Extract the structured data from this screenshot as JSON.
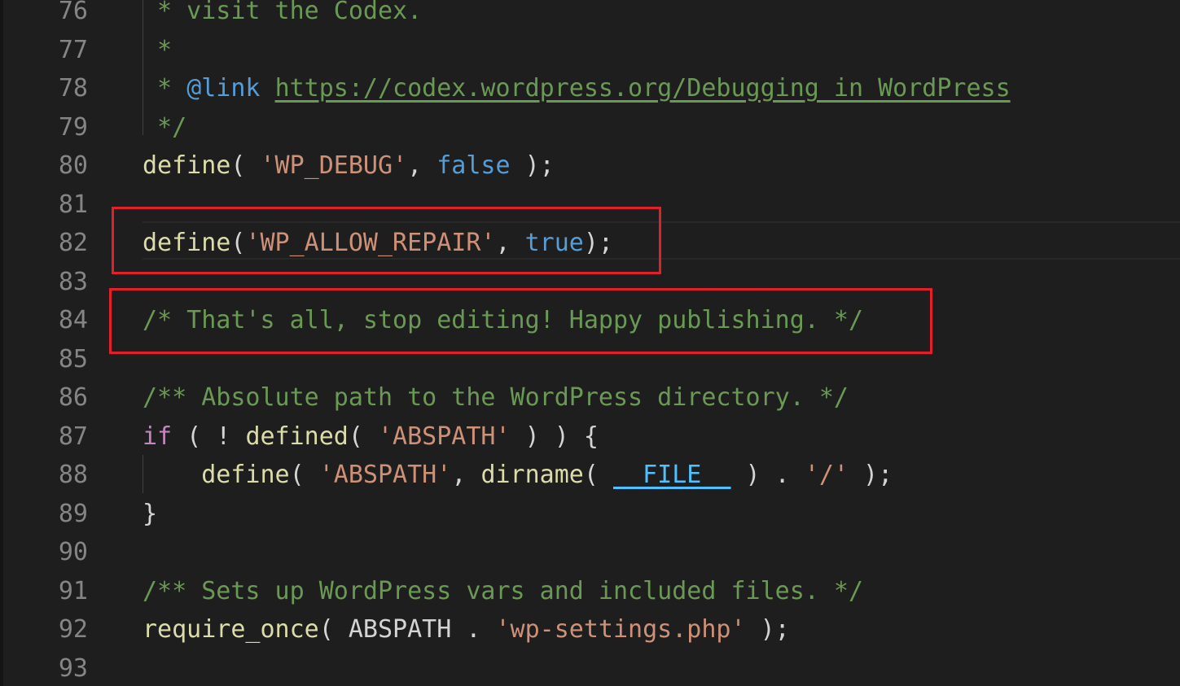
{
  "editor": {
    "lines": [
      {
        "n": "76",
        "tokens": [
          {
            "t": " * visit the Codex.",
            "c": "c-cm"
          }
        ]
      },
      {
        "n": "77",
        "tokens": [
          {
            "t": " *",
            "c": "c-cm"
          }
        ]
      },
      {
        "n": "78",
        "tokens": [
          {
            "t": " * ",
            "c": "c-cm"
          },
          {
            "t": "@link",
            "c": "c-tag"
          },
          {
            "t": " ",
            "c": "c-cm"
          },
          {
            "t": "https://codex.wordpress.org/Debugging_in_WordPress",
            "c": "c-url"
          }
        ]
      },
      {
        "n": "79",
        "tokens": [
          {
            "t": " */",
            "c": "c-cm"
          }
        ]
      },
      {
        "n": "80",
        "tokens": [
          {
            "t": "define",
            "c": "c-fn"
          },
          {
            "t": "( ",
            "c": "c-txt"
          },
          {
            "t": "'WP_DEBUG'",
            "c": "c-str"
          },
          {
            "t": ", ",
            "c": "c-txt"
          },
          {
            "t": "false",
            "c": "c-kw"
          },
          {
            "t": " );",
            "c": "c-txt"
          }
        ]
      },
      {
        "n": "81",
        "tokens": []
      },
      {
        "n": "82",
        "tokens": [
          {
            "t": "define",
            "c": "c-fn"
          },
          {
            "t": "(",
            "c": "c-txt"
          },
          {
            "t": "'WP_ALLOW_REPAIR'",
            "c": "c-str"
          },
          {
            "t": ", ",
            "c": "c-txt"
          },
          {
            "t": "true",
            "c": "c-kw"
          },
          {
            "t": ");",
            "c": "c-txt"
          }
        ]
      },
      {
        "n": "83",
        "tokens": []
      },
      {
        "n": "84",
        "tokens": [
          {
            "t": "/* That's all, stop editing! Happy publishing. */",
            "c": "c-cm"
          }
        ]
      },
      {
        "n": "85",
        "tokens": []
      },
      {
        "n": "86",
        "tokens": [
          {
            "t": "/** Absolute path to the WordPress directory. */",
            "c": "c-cm"
          }
        ]
      },
      {
        "n": "87",
        "tokens": [
          {
            "t": "if",
            "c": "c-ctl"
          },
          {
            "t": " ( ! ",
            "c": "c-txt"
          },
          {
            "t": "defined",
            "c": "c-fn"
          },
          {
            "t": "( ",
            "c": "c-txt"
          },
          {
            "t": "'ABSPATH'",
            "c": "c-str"
          },
          {
            "t": " ) ) {",
            "c": "c-txt"
          }
        ]
      },
      {
        "n": "88",
        "tokens": [
          {
            "t": "    ",
            "c": "c-txt"
          },
          {
            "t": "define",
            "c": "c-fn"
          },
          {
            "t": "( ",
            "c": "c-txt"
          },
          {
            "t": "'ABSPATH'",
            "c": "c-str"
          },
          {
            "t": ", ",
            "c": "c-txt"
          },
          {
            "t": "dirname",
            "c": "c-fn"
          },
          {
            "t": "( ",
            "c": "c-txt"
          },
          {
            "t": "__FILE__",
            "c": "c-const"
          },
          {
            "t": " ) . ",
            "c": "c-txt"
          },
          {
            "t": "'/'",
            "c": "c-str"
          },
          {
            "t": " );",
            "c": "c-txt"
          }
        ]
      },
      {
        "n": "89",
        "tokens": [
          {
            "t": "}",
            "c": "c-txt"
          }
        ]
      },
      {
        "n": "90",
        "tokens": []
      },
      {
        "n": "91",
        "tokens": [
          {
            "t": "/** Sets up WordPress vars and included files. */",
            "c": "c-cm"
          }
        ]
      },
      {
        "n": "92",
        "tokens": [
          {
            "t": "require_once",
            "c": "c-fn"
          },
          {
            "t": "( ABSPATH . ",
            "c": "c-txt"
          },
          {
            "t": "'wp-settings.php'",
            "c": "c-str"
          },
          {
            "t": " );",
            "c": "c-txt"
          }
        ]
      },
      {
        "n": "93",
        "tokens": []
      }
    ],
    "colors": {
      "background": "#1e1e1e",
      "line_number": "#858585",
      "comment": "#6a9955",
      "function": "#dcdcaa",
      "string": "#ce9178",
      "keyword": "#569cd6",
      "control": "#c586c0",
      "highlight_box": "#e0202c"
    }
  }
}
